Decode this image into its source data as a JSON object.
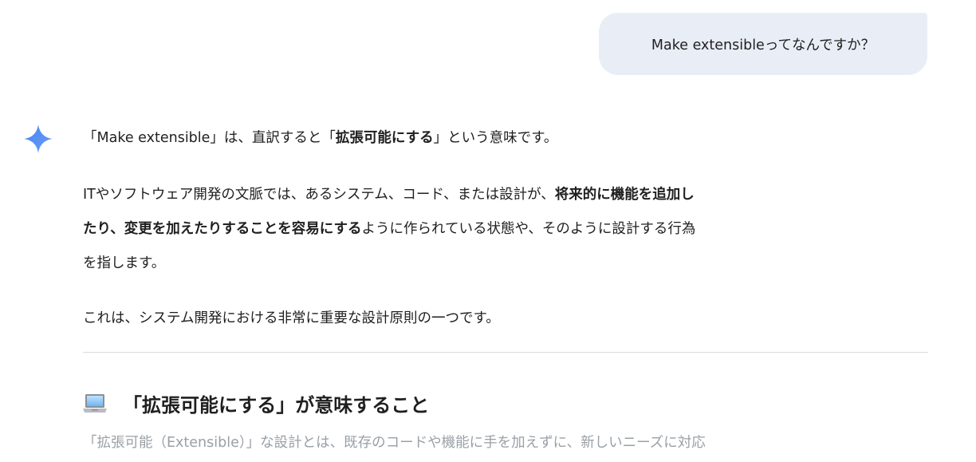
{
  "user_message": {
    "text": "Make extensibleってなんですか？"
  },
  "response": {
    "p1": {
      "a": "「Make extensible」は、直訳すると「",
      "b": "拡張可能にする",
      "c": "」という意味です。"
    },
    "p2": {
      "line1_a": "ITやソフトウェア開発の文脈では、あるシステム、コード、または設計が、",
      "line1_b": "将来的に機能を追加し",
      "line2_b": "たり、変更を加えたりすることを容易にする",
      "line2_c": "ように作られている状態や、そのように設計する行為",
      "line3": "を指します。"
    },
    "p3": "これは、システム開発における非常に重要な設計原則の一つです。",
    "section_heading": "「拡張可能にする」が意味すること",
    "section_text": "「拡張可能（Extensible）」な設計とは、既存のコードや機能に手を加えずに、新しいニーズに対応"
  },
  "icons": {
    "assistant": "gemini-sparkle-icon",
    "section": "laptop-icon"
  },
  "colors": {
    "user_bubble_bg": "#e9eef6",
    "sparkle_start": "#4285f4",
    "sparkle_end": "#6f9cf7",
    "faded_text": "#9aa0a6"
  }
}
